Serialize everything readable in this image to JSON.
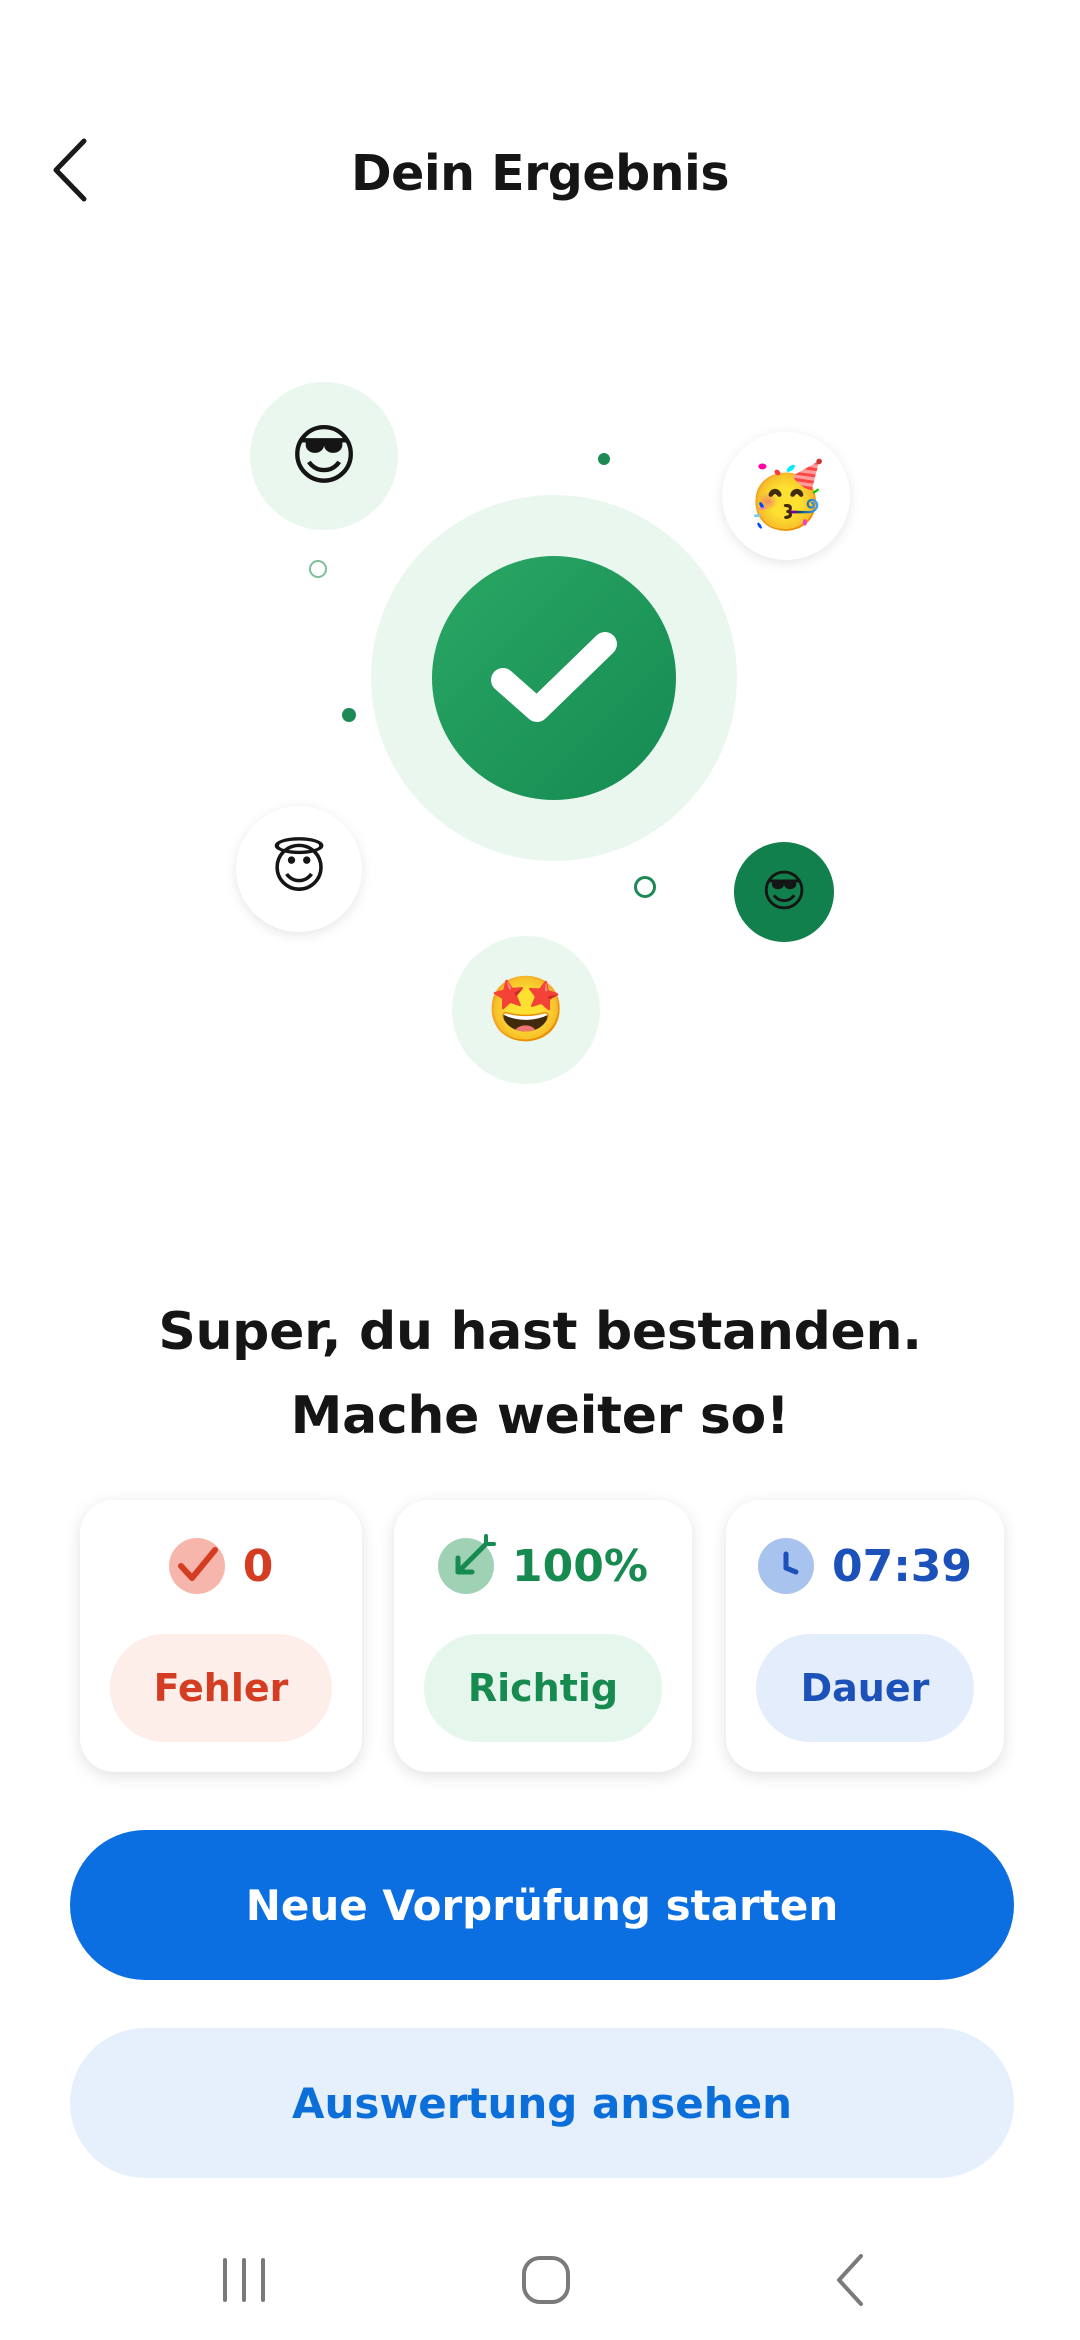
{
  "header": {
    "title": "Dein Ergebnis",
    "back_icon": "chevron-left-icon"
  },
  "hero": {
    "center_icon": "checkmark-icon",
    "emojis": {
      "top_left": "😎",
      "top_right": "🥳",
      "mid_left": "😇",
      "mid_right": "😎",
      "bottom": "🤩"
    }
  },
  "message": {
    "line1": "Super, du hast bestanden.",
    "line2": "Mache weiter so!"
  },
  "stats": {
    "errors": {
      "value": "0",
      "label": "Fehler",
      "icon": "check-mark-icon",
      "color": "#d43d22"
    },
    "correct": {
      "value": "100%",
      "label": "Richtig",
      "icon": "target-arrow-icon",
      "color": "#178a4f"
    },
    "duration": {
      "value": "07:39",
      "label": "Dauer",
      "icon": "clock-icon",
      "color": "#1b51b8"
    }
  },
  "actions": {
    "primary": "Neue Vorprüfung starten",
    "secondary": "Auswertung ansehen"
  },
  "system_nav": {
    "recents": "recents-icon",
    "home": "home-icon",
    "back": "back-icon"
  }
}
